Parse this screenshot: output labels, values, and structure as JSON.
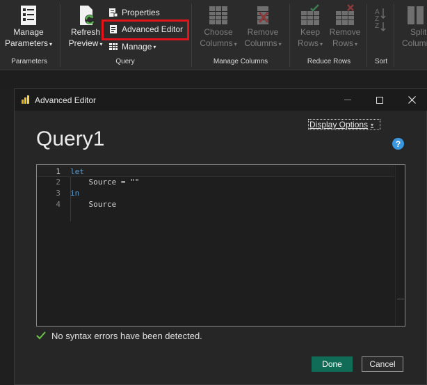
{
  "ribbon": {
    "groups": {
      "parameters": {
        "label": "Parameters",
        "manage_line1": "Manage",
        "manage_line2": "Parameters"
      },
      "query": {
        "label": "Query",
        "refresh_line1": "Refresh",
        "refresh_line2": "Preview",
        "properties": "Properties",
        "advanced_editor": "Advanced Editor",
        "manage": "Manage"
      },
      "manage_columns": {
        "label": "Manage Columns",
        "choose_line1": "Choose",
        "choose_line2": "Columns",
        "remove_line1": "Remove",
        "remove_line2": "Columns"
      },
      "reduce_rows": {
        "label": "Reduce Rows",
        "keep_line1": "Keep",
        "keep_line2": "Rows",
        "remove_line1": "Remove",
        "remove_line2": "Rows"
      },
      "sort": {
        "label": "Sort"
      },
      "split": {
        "line1": "Split",
        "line2": "Column"
      }
    },
    "highlight_color": "#e3141b"
  },
  "dialog": {
    "title": "Advanced Editor",
    "query_name": "Query1",
    "display_options": "Display Options",
    "help_glyph": "?",
    "code": {
      "line_numbers": [
        "1",
        "2",
        "3",
        "4"
      ],
      "lines": [
        {
          "kw": "let",
          "text": ""
        },
        {
          "kw": "",
          "text": "    Source = \"\""
        },
        {
          "kw": "in",
          "text": ""
        },
        {
          "kw": "",
          "text": "    Source"
        }
      ]
    },
    "status": "No syntax errors have been detected.",
    "done": "Done",
    "cancel": "Cancel",
    "accent": "#106c56"
  }
}
